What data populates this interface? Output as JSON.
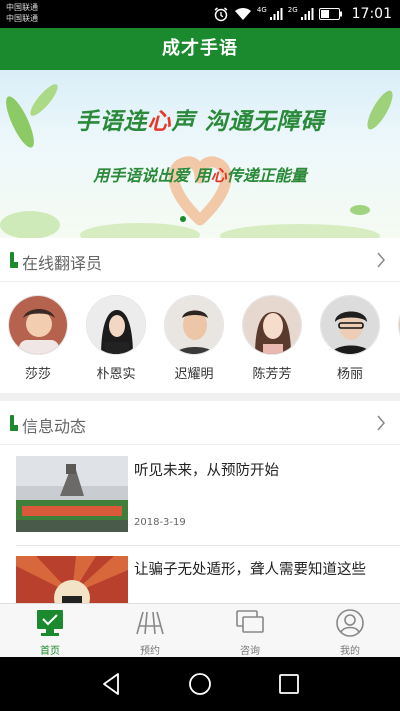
{
  "status_bar": {
    "carrier_1": "中国联通",
    "carrier_2": "中国联通",
    "network_1": "4G",
    "network_2": "2G",
    "time": "17:01"
  },
  "app": {
    "title": "成才手语"
  },
  "banner": {
    "headline_part1": "手语连",
    "headline_heart": "心",
    "headline_part2": "声 沟通无障碍",
    "subline_part1": "用手语说出爱 用",
    "subline_heart": "心",
    "subline_part2": "传递正能量"
  },
  "translators_section": {
    "title": "在线翻译员",
    "items": [
      {
        "name": "莎莎"
      },
      {
        "name": "朴恩实"
      },
      {
        "name": "迟耀明"
      },
      {
        "name": "陈芳芳"
      },
      {
        "name": "杨丽"
      }
    ]
  },
  "news_section": {
    "title": "信息动态",
    "items": [
      {
        "title": "听见未来，从预防开始",
        "date": "2018-3-19"
      },
      {
        "title": "让骗子无处遁形，聋人需要知道这些",
        "date": ""
      }
    ]
  },
  "tabs": [
    {
      "label": "首页",
      "icon": "home-monitor-icon",
      "active": true
    },
    {
      "label": "预约",
      "icon": "appointment-icon",
      "active": false
    },
    {
      "label": "咨询",
      "icon": "consult-chat-icon",
      "active": false
    },
    {
      "label": "我的",
      "icon": "profile-icon",
      "active": false
    }
  ],
  "colors": {
    "accent": "#1b8a2e",
    "heart": "#e53a2a"
  }
}
